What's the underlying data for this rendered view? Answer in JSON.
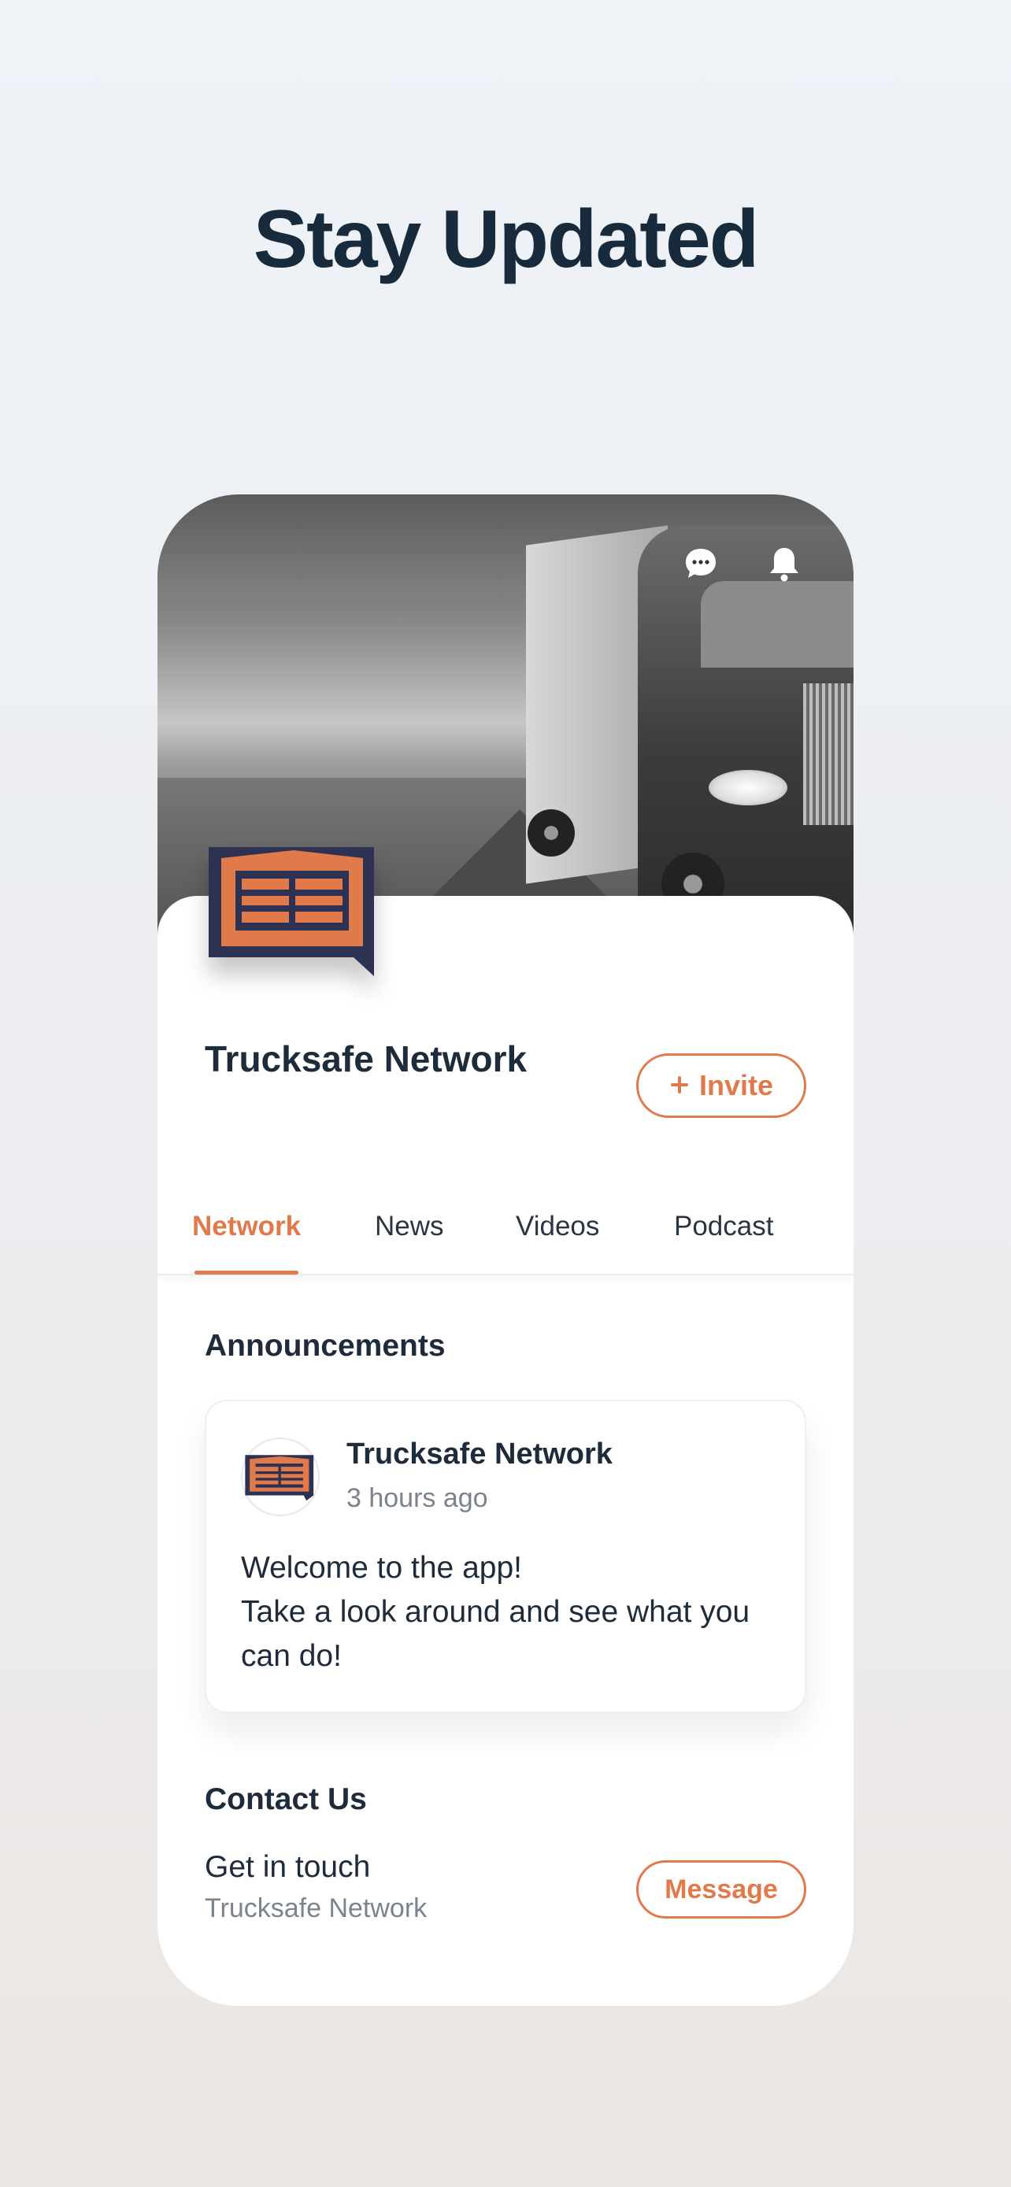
{
  "headline": "Stay Updated",
  "header": {
    "icons": [
      "chat-bubble-icon",
      "bell-icon"
    ]
  },
  "profile": {
    "name": "Trucksafe Network",
    "invite_label": "Invite",
    "invite_icon": "plus-icon"
  },
  "tabs": [
    {
      "label": "Network",
      "active": true
    },
    {
      "label": "News",
      "active": false
    },
    {
      "label": "Videos",
      "active": false
    },
    {
      "label": "Podcast",
      "active": false
    }
  ],
  "announcements": {
    "title": "Announcements",
    "post": {
      "author": "Trucksafe Network",
      "time": "3 hours ago",
      "body_line1": "Welcome to the app!",
      "body_line2": "Take a look around and see what you can do!"
    }
  },
  "contact": {
    "title": "Contact Us",
    "line": "Get in touch",
    "sub": "Trucksafe Network",
    "button_label": "Message"
  },
  "colors": {
    "accent": "#e07a4a",
    "navy": "#1d2b3a",
    "logo_navy": "#2d3152"
  }
}
